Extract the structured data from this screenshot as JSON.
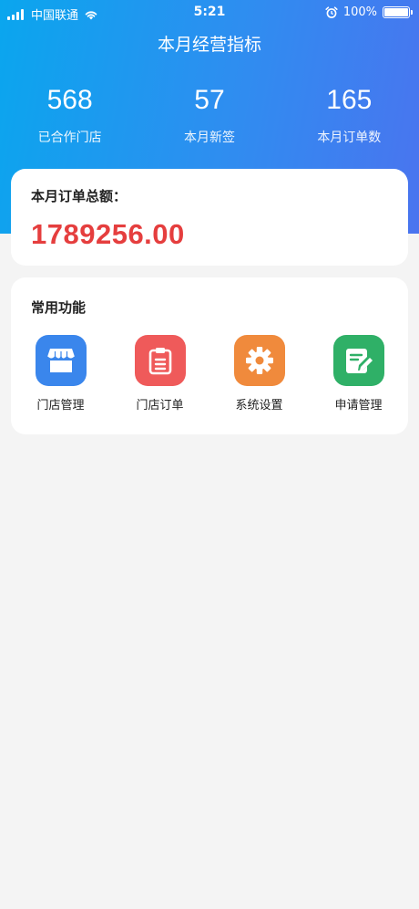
{
  "status_bar": {
    "carrier": "中国联通",
    "time": "5:21",
    "battery": "100%"
  },
  "header": {
    "title": "本月经营指标"
  },
  "stats": [
    {
      "value": "568",
      "label": "已合作门店"
    },
    {
      "value": "57",
      "label": "本月新签"
    },
    {
      "value": "165",
      "label": "本月订单数"
    }
  ],
  "total": {
    "title": "本月订单总额：",
    "amount": "1789256.00"
  },
  "functions": {
    "title": "常用功能",
    "items": [
      {
        "label": "门店管理",
        "icon": "store-icon",
        "color": "#3a86ec"
      },
      {
        "label": "门店订单",
        "icon": "clipboard-icon",
        "color": "#ef5a5a"
      },
      {
        "label": "系统设置",
        "icon": "gear-icon",
        "color": "#f08a3c"
      },
      {
        "label": "申请管理",
        "icon": "edit-document-icon",
        "color": "#2fb067"
      }
    ]
  },
  "colors": {
    "hero_gradient_start": "#0aa6ee",
    "hero_gradient_end": "#4a74ef",
    "amount": "#e53e3e",
    "background": "#f4f4f4"
  }
}
